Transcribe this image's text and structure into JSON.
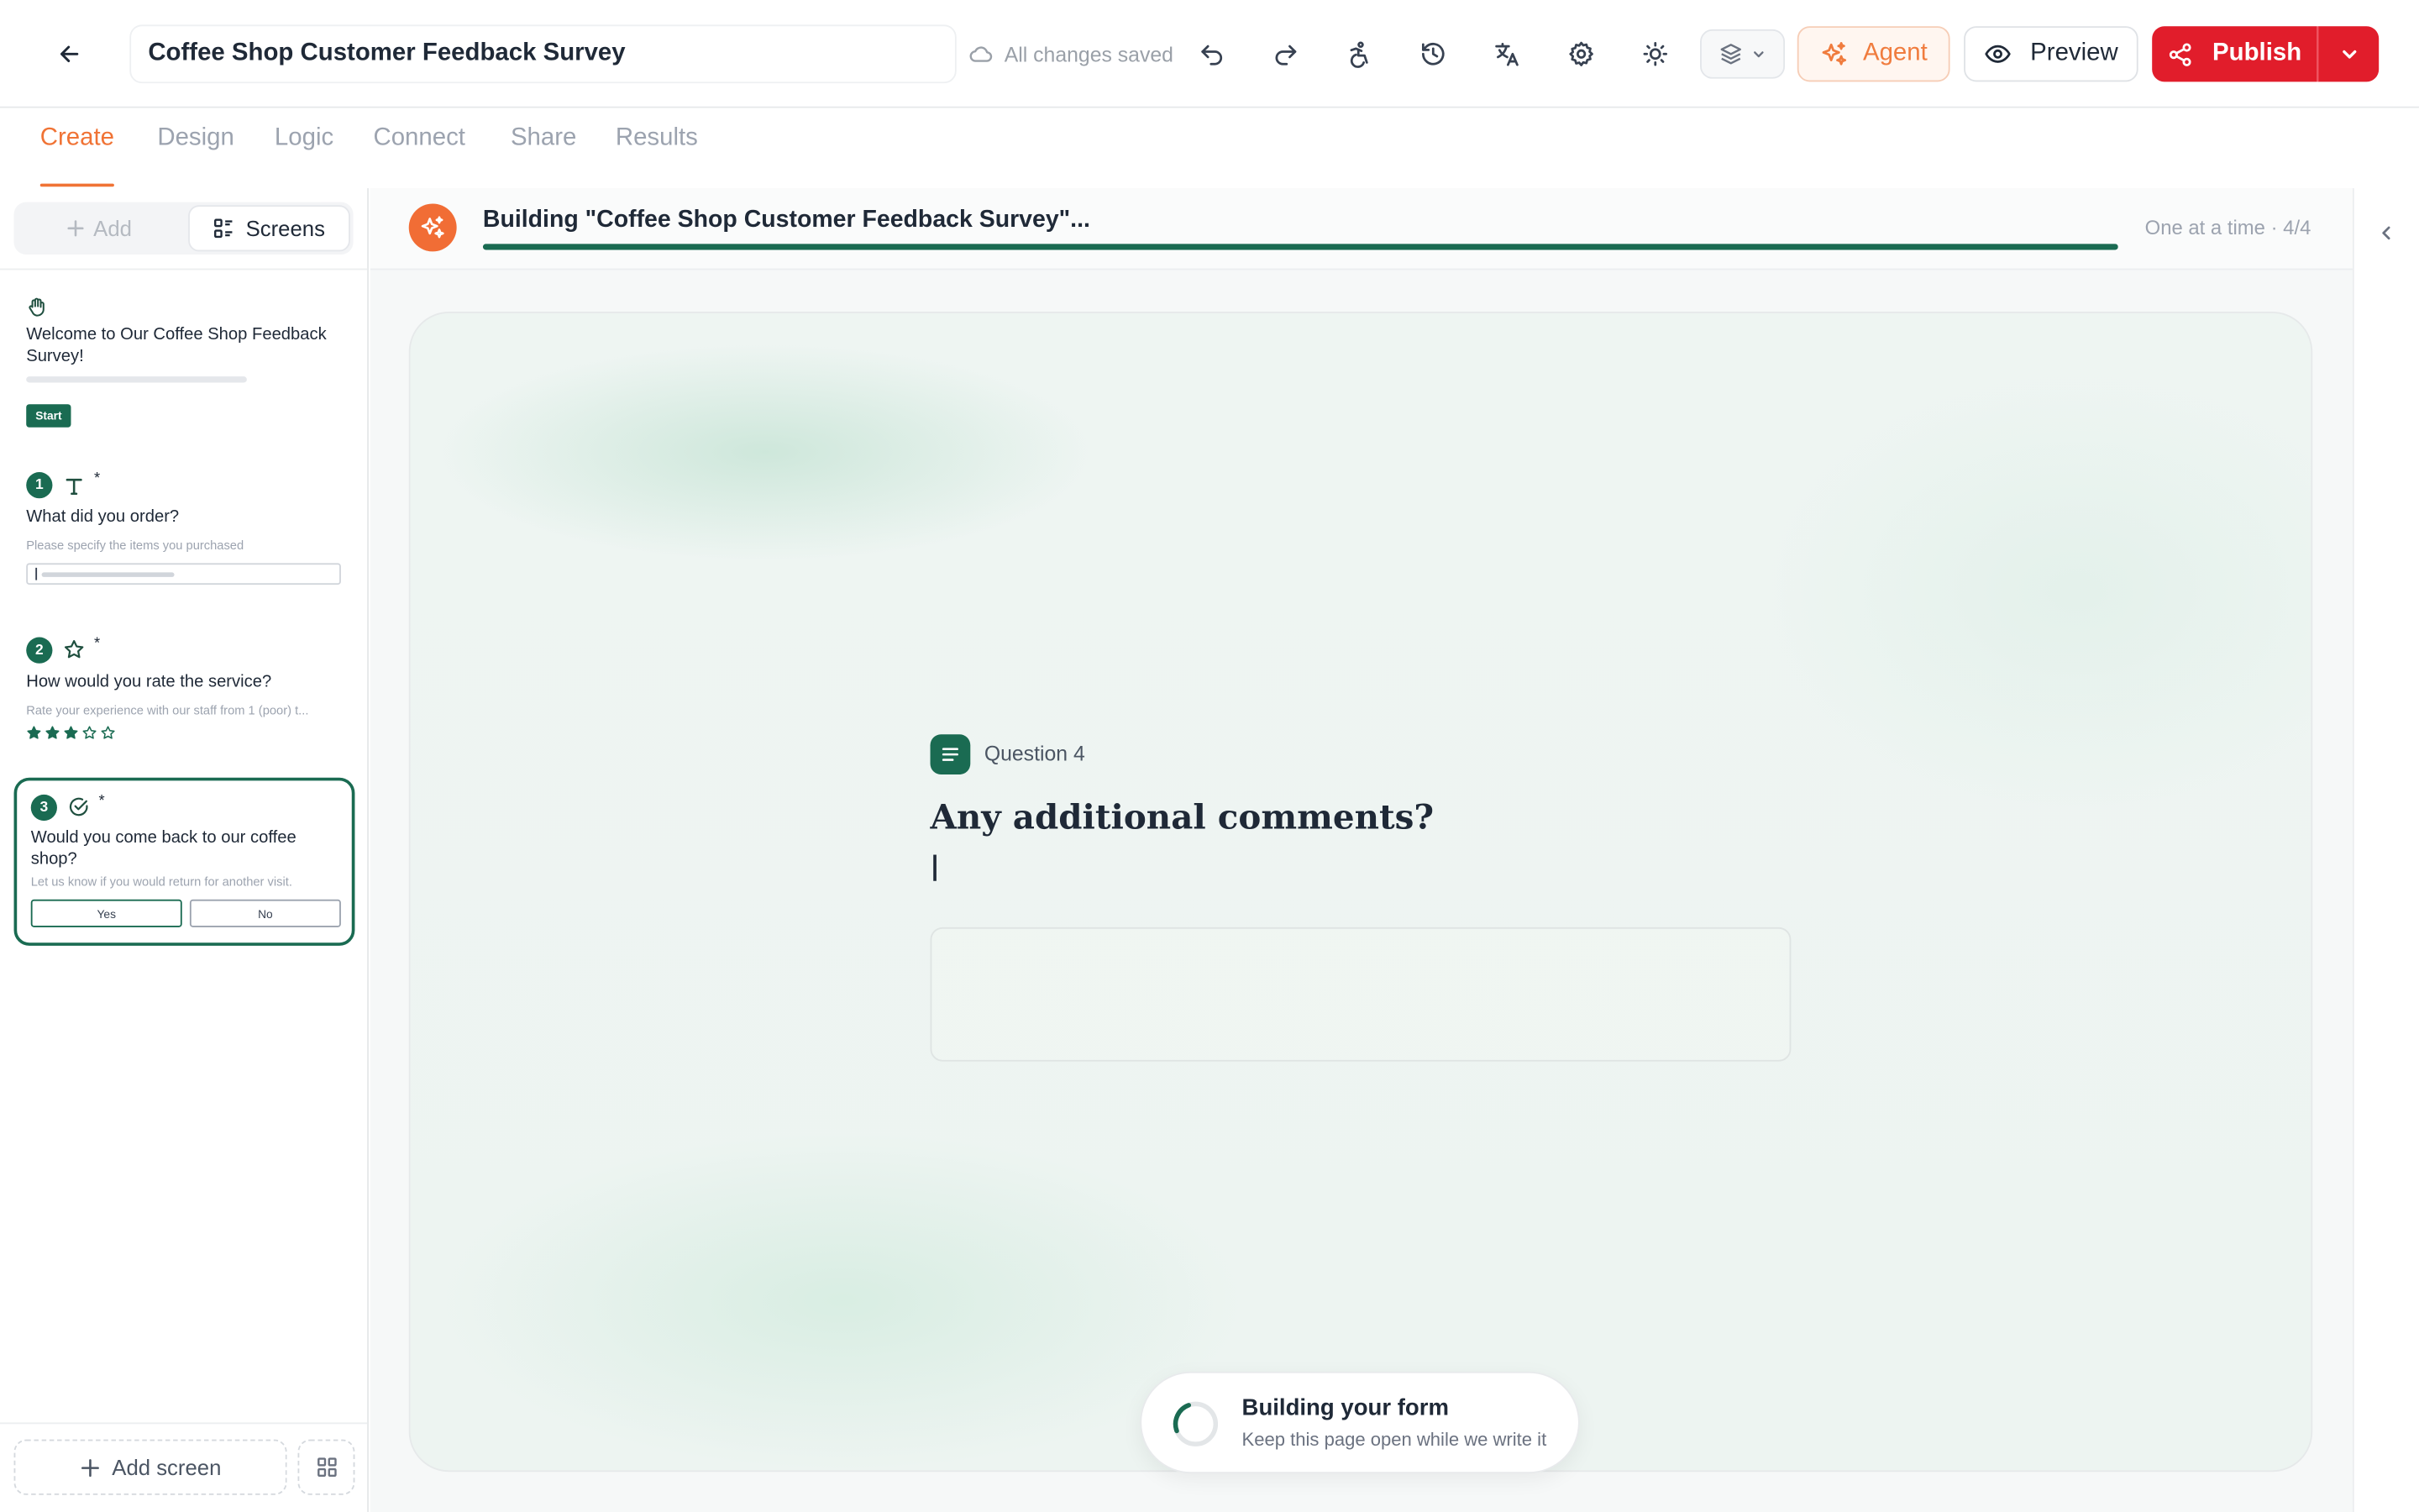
{
  "header": {
    "form_title": "Coffee Shop Customer Feedback Survey",
    "save_status": "All changes saved",
    "icons": [
      "back-arrow-icon",
      "cloud-icon",
      "undo-icon",
      "redo-icon",
      "accessibility-icon",
      "history-icon",
      "translate-icon",
      "settings-icon",
      "theme-sun-icon",
      "layers-icon",
      "sparkles-icon",
      "eye-icon",
      "share-icon",
      "chevron-down-icon"
    ],
    "agent_label": "Agent",
    "preview_label": "Preview",
    "publish_label": "Publish"
  },
  "tabs": [
    {
      "label": "Create",
      "active": true
    },
    {
      "label": "Design",
      "active": false
    },
    {
      "label": "Logic",
      "active": false
    },
    {
      "label": "Connect",
      "active": false
    },
    {
      "label": "Share",
      "active": false
    },
    {
      "label": "Results",
      "active": false
    }
  ],
  "sidebar": {
    "add_label": "Add",
    "screens_label": "Screens",
    "welcome": {
      "title": "Welcome to Our Coffee Shop Feedback Survey!",
      "button": "Start"
    },
    "questions": [
      {
        "number": "1",
        "required_mark": "*",
        "title": "What did you order?",
        "description": "Please specify the items you purchased",
        "type_icon": "text-icon"
      },
      {
        "number": "2",
        "required_mark": "*",
        "title": "How would you rate the service?",
        "description": "Rate your experience with our staff from 1 (poor) t...",
        "type_icon": "star-icon",
        "rating": 3,
        "max_rating": 5
      },
      {
        "number": "3",
        "required_mark": "*",
        "title": "Would you come back to our coffee shop?",
        "description": "Let us know if you would return for another visit.",
        "type_icon": "check-circle-icon",
        "options": [
          "Yes",
          "No"
        ]
      }
    ],
    "add_screen_label": "Add screen"
  },
  "builder": {
    "title": "Building \"Coffee Shop Customer Feedback Survey\"...",
    "progress": 1.0,
    "meta": "One at a time · 4/4"
  },
  "canvas": {
    "question_label": "Question 4",
    "question_title": "Any additional comments?"
  },
  "toast": {
    "title": "Building your form",
    "subtitle": "Keep this page open while we write it"
  },
  "colors": {
    "brand_green": "#1a6b52",
    "accent_orange": "#f07335",
    "publish_red": "#e11d2b"
  }
}
